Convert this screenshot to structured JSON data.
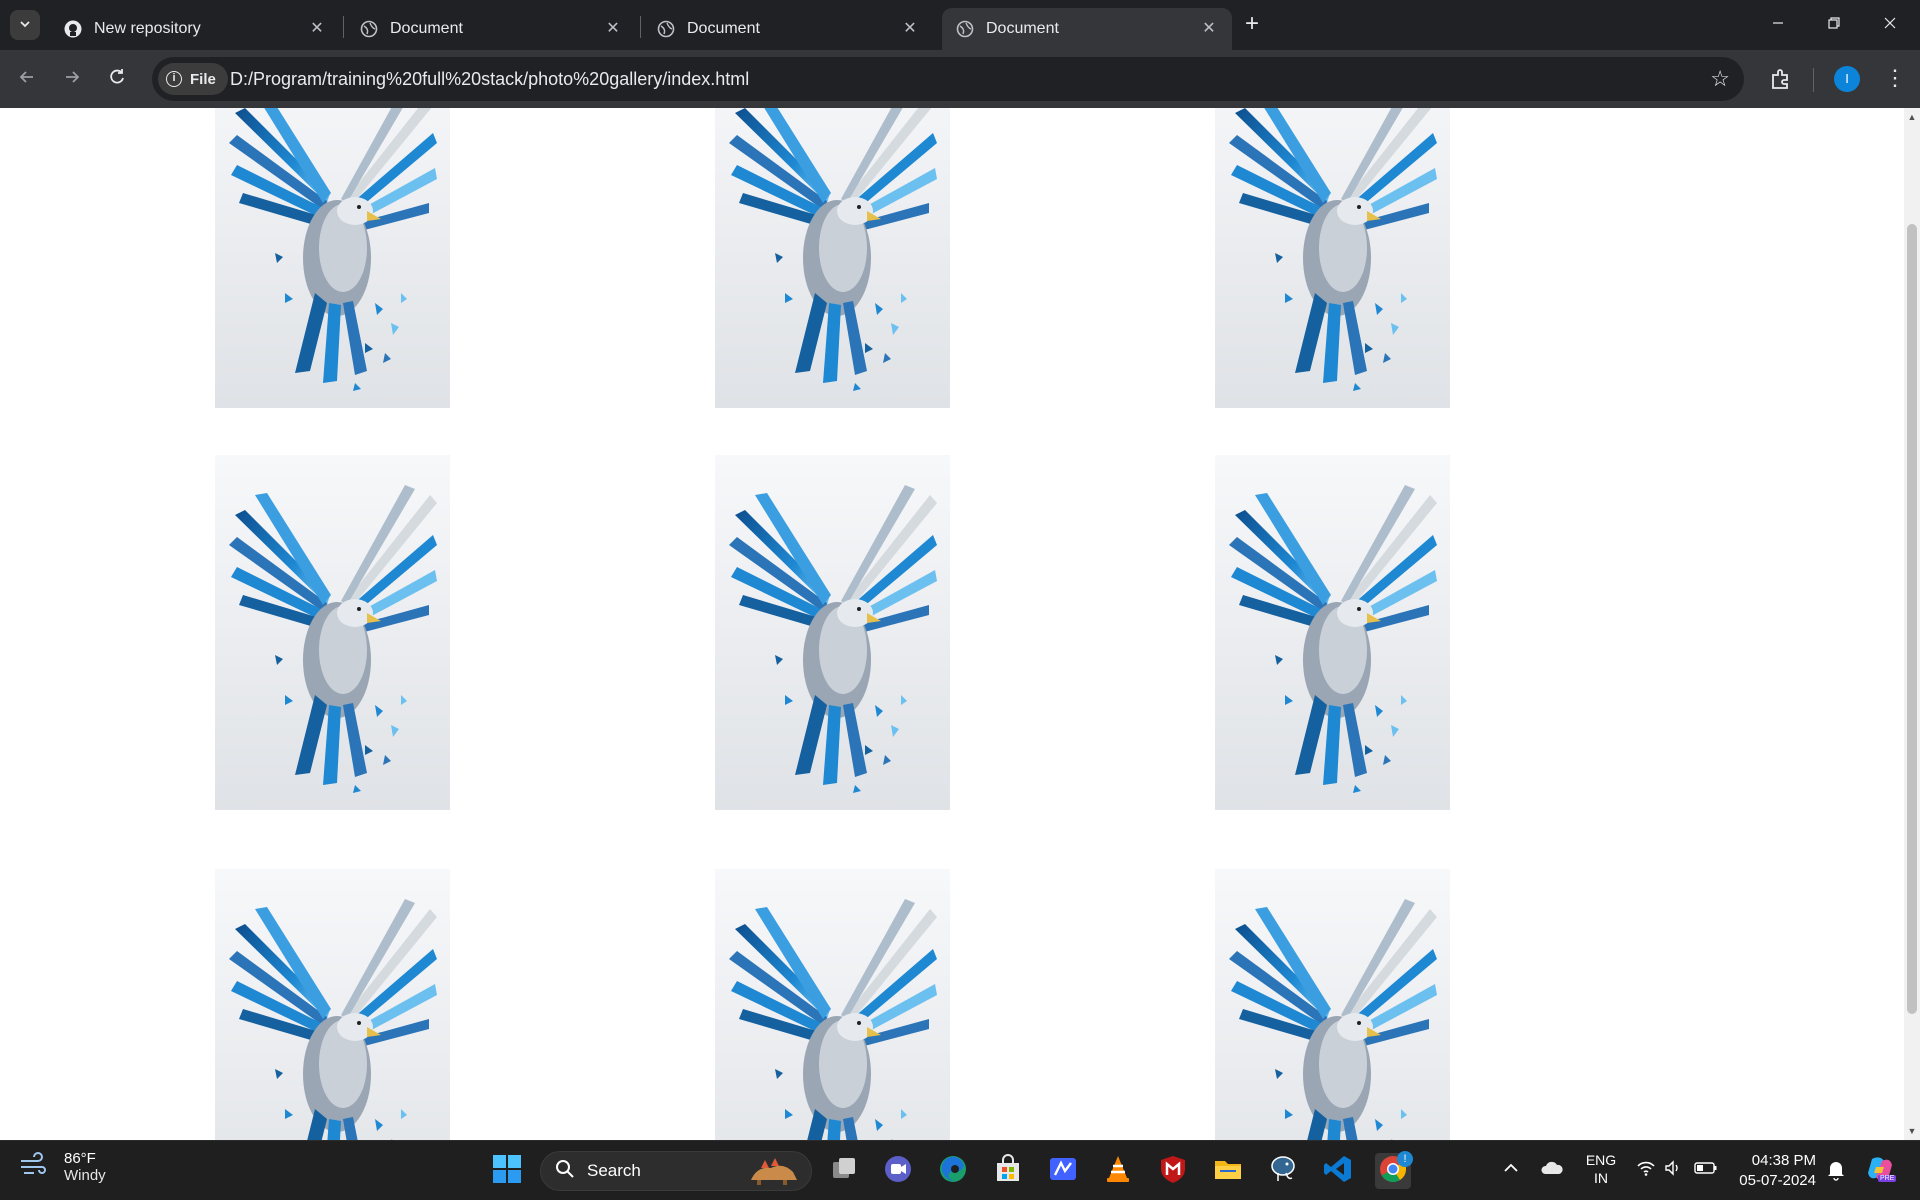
{
  "browser": {
    "tabs": [
      {
        "title": "New repository",
        "icon": "github-icon",
        "active": false
      },
      {
        "title": "Document",
        "icon": "globe-icon",
        "active": false
      },
      {
        "title": "Document",
        "icon": "globe-icon",
        "active": false
      },
      {
        "title": "Document",
        "icon": "globe-icon",
        "active": true
      }
    ],
    "site_chip_label": "File",
    "url": "D:/Program/training%20full%20stack/photo%20gallery/index.html",
    "profile_initial": "I"
  },
  "gallery": {
    "images": [
      {
        "subject": "blue-eagle"
      },
      {
        "subject": "blue-eagle"
      },
      {
        "subject": "blue-eagle"
      },
      {
        "subject": "blue-eagle"
      },
      {
        "subject": "blue-eagle"
      },
      {
        "subject": "blue-eagle"
      },
      {
        "subject": "blue-eagle"
      },
      {
        "subject": "blue-eagle"
      },
      {
        "subject": "blue-eagle"
      }
    ]
  },
  "taskbar": {
    "weather": {
      "temp": "86°F",
      "desc": "Windy"
    },
    "search_label": "Search",
    "chrome_badge": "!",
    "language": {
      "line1": "ENG",
      "line2": "IN"
    },
    "clock": {
      "time": "04:38 PM",
      "date": "05-07-2024"
    },
    "copilot_label": "PRE"
  },
  "colors": {
    "chrome_dark": "#202124",
    "toolbar": "#35363a",
    "eagle_blue": "#1e88d2",
    "taskbar": "#1f1f1f"
  }
}
